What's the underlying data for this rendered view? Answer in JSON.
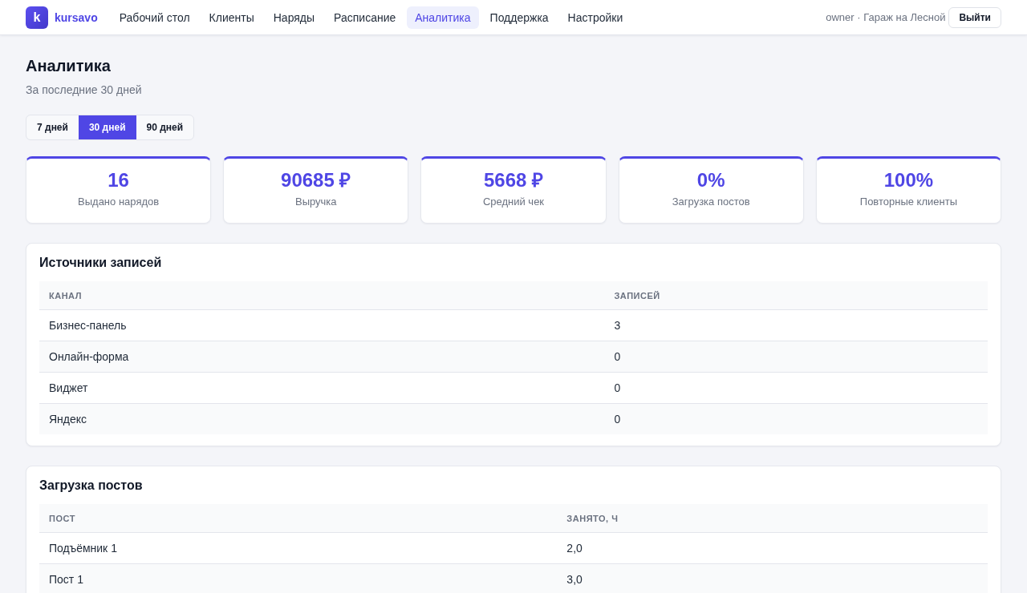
{
  "header": {
    "logo": {
      "letter": "k",
      "name": "kursavo"
    },
    "nav": [
      {
        "label": "Рабочий стол",
        "selected": false
      },
      {
        "label": "Клиенты",
        "selected": false
      },
      {
        "label": "Наряды",
        "selected": false
      },
      {
        "label": "Расписание",
        "selected": false
      },
      {
        "label": "Аналитика",
        "selected": true
      },
      {
        "label": "Поддержка",
        "selected": false
      },
      {
        "label": "Настройки",
        "selected": false
      }
    ],
    "user": "owner · Гараж на Лесной",
    "logout": "Выйти"
  },
  "page": {
    "title": "Аналитика",
    "subtitle": "За последние 30 дней"
  },
  "period_tabs": [
    {
      "label": "7 дней",
      "selected": false
    },
    {
      "label": "30 дней",
      "selected": true
    },
    {
      "label": "90 дней",
      "selected": false
    }
  ],
  "stats": [
    {
      "value": "16",
      "label": "Выдано нарядов"
    },
    {
      "value": "90685 ₽",
      "label": "Выручка"
    },
    {
      "value": "5668 ₽",
      "label": "Средний чек"
    },
    {
      "value": "0%",
      "label": "Загрузка постов"
    },
    {
      "value": "100%",
      "label": "Повторные клиенты"
    }
  ],
  "sections": [
    {
      "title": "Источники записей",
      "columns": [
        "КАНАЛ",
        "ЗАПИСЕЙ"
      ],
      "rows": [
        [
          "Бизнес-панель",
          "3"
        ],
        [
          "Онлайн-форма",
          "0"
        ],
        [
          "Виджет",
          "0"
        ],
        [
          "Яндекс",
          "0"
        ]
      ]
    },
    {
      "title": "Загрузка постов",
      "columns": [
        "ПОСТ",
        "ЗАНЯТО, Ч"
      ],
      "rows": [
        [
          "Подъёмник 1",
          "2,0"
        ],
        [
          "Пост 1",
          "3,0"
        ]
      ]
    }
  ]
}
